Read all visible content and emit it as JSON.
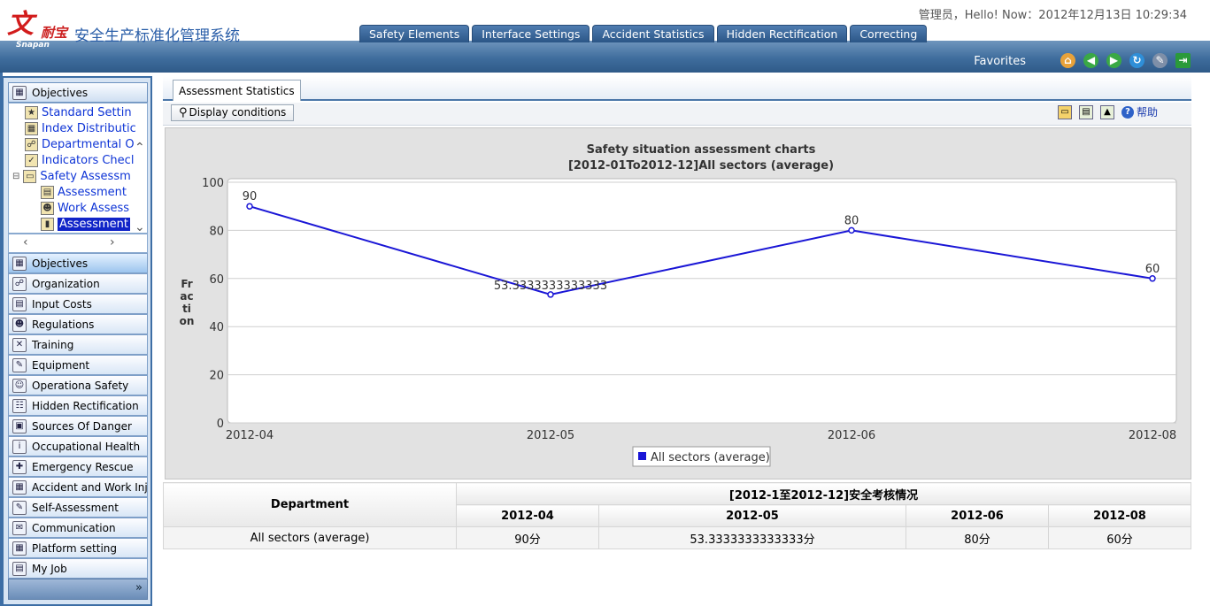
{
  "header": {
    "logo_mark": "文",
    "logo_brand": "耐宝",
    "logo_sub": "Snapan",
    "title": "安全生产标准化管理系统",
    "status": "管理员，Hello! Now：2012年12月13日 10:29:34",
    "tabs": [
      "Safety Elements",
      "Interface Settings",
      "Accident Statistics",
      "Hidden Rectification",
      "Correcting"
    ],
    "favorites": "Favorites",
    "fav_icons": [
      "home-icon",
      "back-icon",
      "forward-icon",
      "refresh-icon",
      "tools-icon",
      "exit-icon"
    ],
    "colors": {
      "brand": "#d21c1c",
      "band": "#3f6d9d",
      "title": "#2a5ea8"
    }
  },
  "sidebar": {
    "tree_title": "Objectives",
    "tree": [
      {
        "label": "Standard Settin",
        "icon": "star-icon",
        "level": 1
      },
      {
        "label": "Index Distributic",
        "icon": "grid-icon",
        "level": 1
      },
      {
        "label": "Departmental O",
        "icon": "org-icon",
        "level": 1
      },
      {
        "label": "Indicators Checl",
        "icon": "check-icon",
        "level": 1
      },
      {
        "label": "Safety Assessm",
        "icon": "folder-icon",
        "level": 1,
        "expanded": true
      },
      {
        "label": "Assessment",
        "icon": "doc-icon",
        "level": 2
      },
      {
        "label": "Work Assess",
        "icon": "user-icon",
        "level": 2
      },
      {
        "label": "Assessment",
        "icon": "chart-icon",
        "level": 2,
        "selected": true
      }
    ],
    "nav": [
      {
        "label": "Objectives",
        "icon": "objectives-icon",
        "active": true
      },
      {
        "label": "Organization",
        "icon": "organization-icon"
      },
      {
        "label": "Input Costs",
        "icon": "costs-icon"
      },
      {
        "label": "Regulations",
        "icon": "regulations-icon"
      },
      {
        "label": "Training",
        "icon": "training-icon"
      },
      {
        "label": "Equipment",
        "icon": "equipment-icon"
      },
      {
        "label": "Operationa Safety",
        "icon": "operation-icon"
      },
      {
        "label": "Hidden Rectification",
        "icon": "rectification-icon"
      },
      {
        "label": "Sources Of Danger",
        "icon": "danger-icon"
      },
      {
        "label": "Occupational Health",
        "icon": "health-icon"
      },
      {
        "label": "Emergency Rescue",
        "icon": "rescue-icon"
      },
      {
        "label": "Accident and Work Injury",
        "icon": "accident-icon"
      },
      {
        "label": "Self-Assessment",
        "icon": "self-assessment-icon"
      },
      {
        "label": "Communication",
        "icon": "communication-icon"
      },
      {
        "label": "Platform setting",
        "icon": "platform-icon"
      },
      {
        "label": "My Job",
        "icon": "job-icon"
      }
    ]
  },
  "main": {
    "tab": "Assessment Statistics",
    "display_button": "Display conditions",
    "help": "帮助"
  },
  "chart_data": {
    "type": "line",
    "title": "Safety situation assessment charts",
    "subtitle": "[2012-01To2012-12]All sectors (average)",
    "ylabel": "Fraction",
    "xlabel": "",
    "categories": [
      "2012-04",
      "2012-05",
      "2012-06",
      "2012-08"
    ],
    "series": [
      {
        "name": "All sectors (average)",
        "values": [
          90,
          53.3333333333333,
          80,
          60
        ],
        "labels": [
          "90",
          "53.3333333333333",
          "80",
          "60"
        ],
        "color": "#1a16d6"
      }
    ],
    "ylim": [
      0,
      100
    ],
    "yticks": [
      0,
      20,
      40,
      60,
      80,
      100
    ],
    "grid": true,
    "legend": "bottom-center"
  },
  "table": {
    "corner": "Department",
    "group": "[2012-1至2012-12]安全考核情况",
    "months": [
      "2012-04",
      "2012-05",
      "2012-06",
      "2012-08"
    ],
    "rows": [
      {
        "dept": "All sectors (average)",
        "values": [
          "90分",
          "53.3333333333333分",
          "80分",
          "60分"
        ]
      }
    ]
  }
}
